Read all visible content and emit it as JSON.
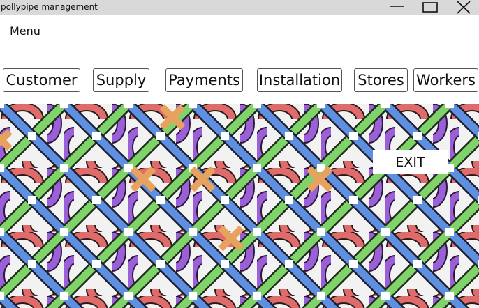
{
  "window": {
    "title": "pollypipe management",
    "controls": {
      "minimize_icon": "minimize-icon",
      "maximize_icon": "maximize-icon",
      "close_icon": "close-icon"
    }
  },
  "menu": {
    "label": "Menu"
  },
  "nav": {
    "customer": "Customer",
    "supply": "Supply",
    "payments": "Payments",
    "installation": "Installation",
    "stores": "Stores",
    "workers": "Workers"
  },
  "exit_label": "EXIT",
  "colors": {
    "titlebar": "#d9d9d9",
    "pipe_red": "#e06b6b",
    "pipe_purple": "#9b5fd8",
    "pipe_green": "#7fd36a",
    "pipe_blue": "#5f8fe0",
    "pipe_orange": "#e7a25f"
  }
}
